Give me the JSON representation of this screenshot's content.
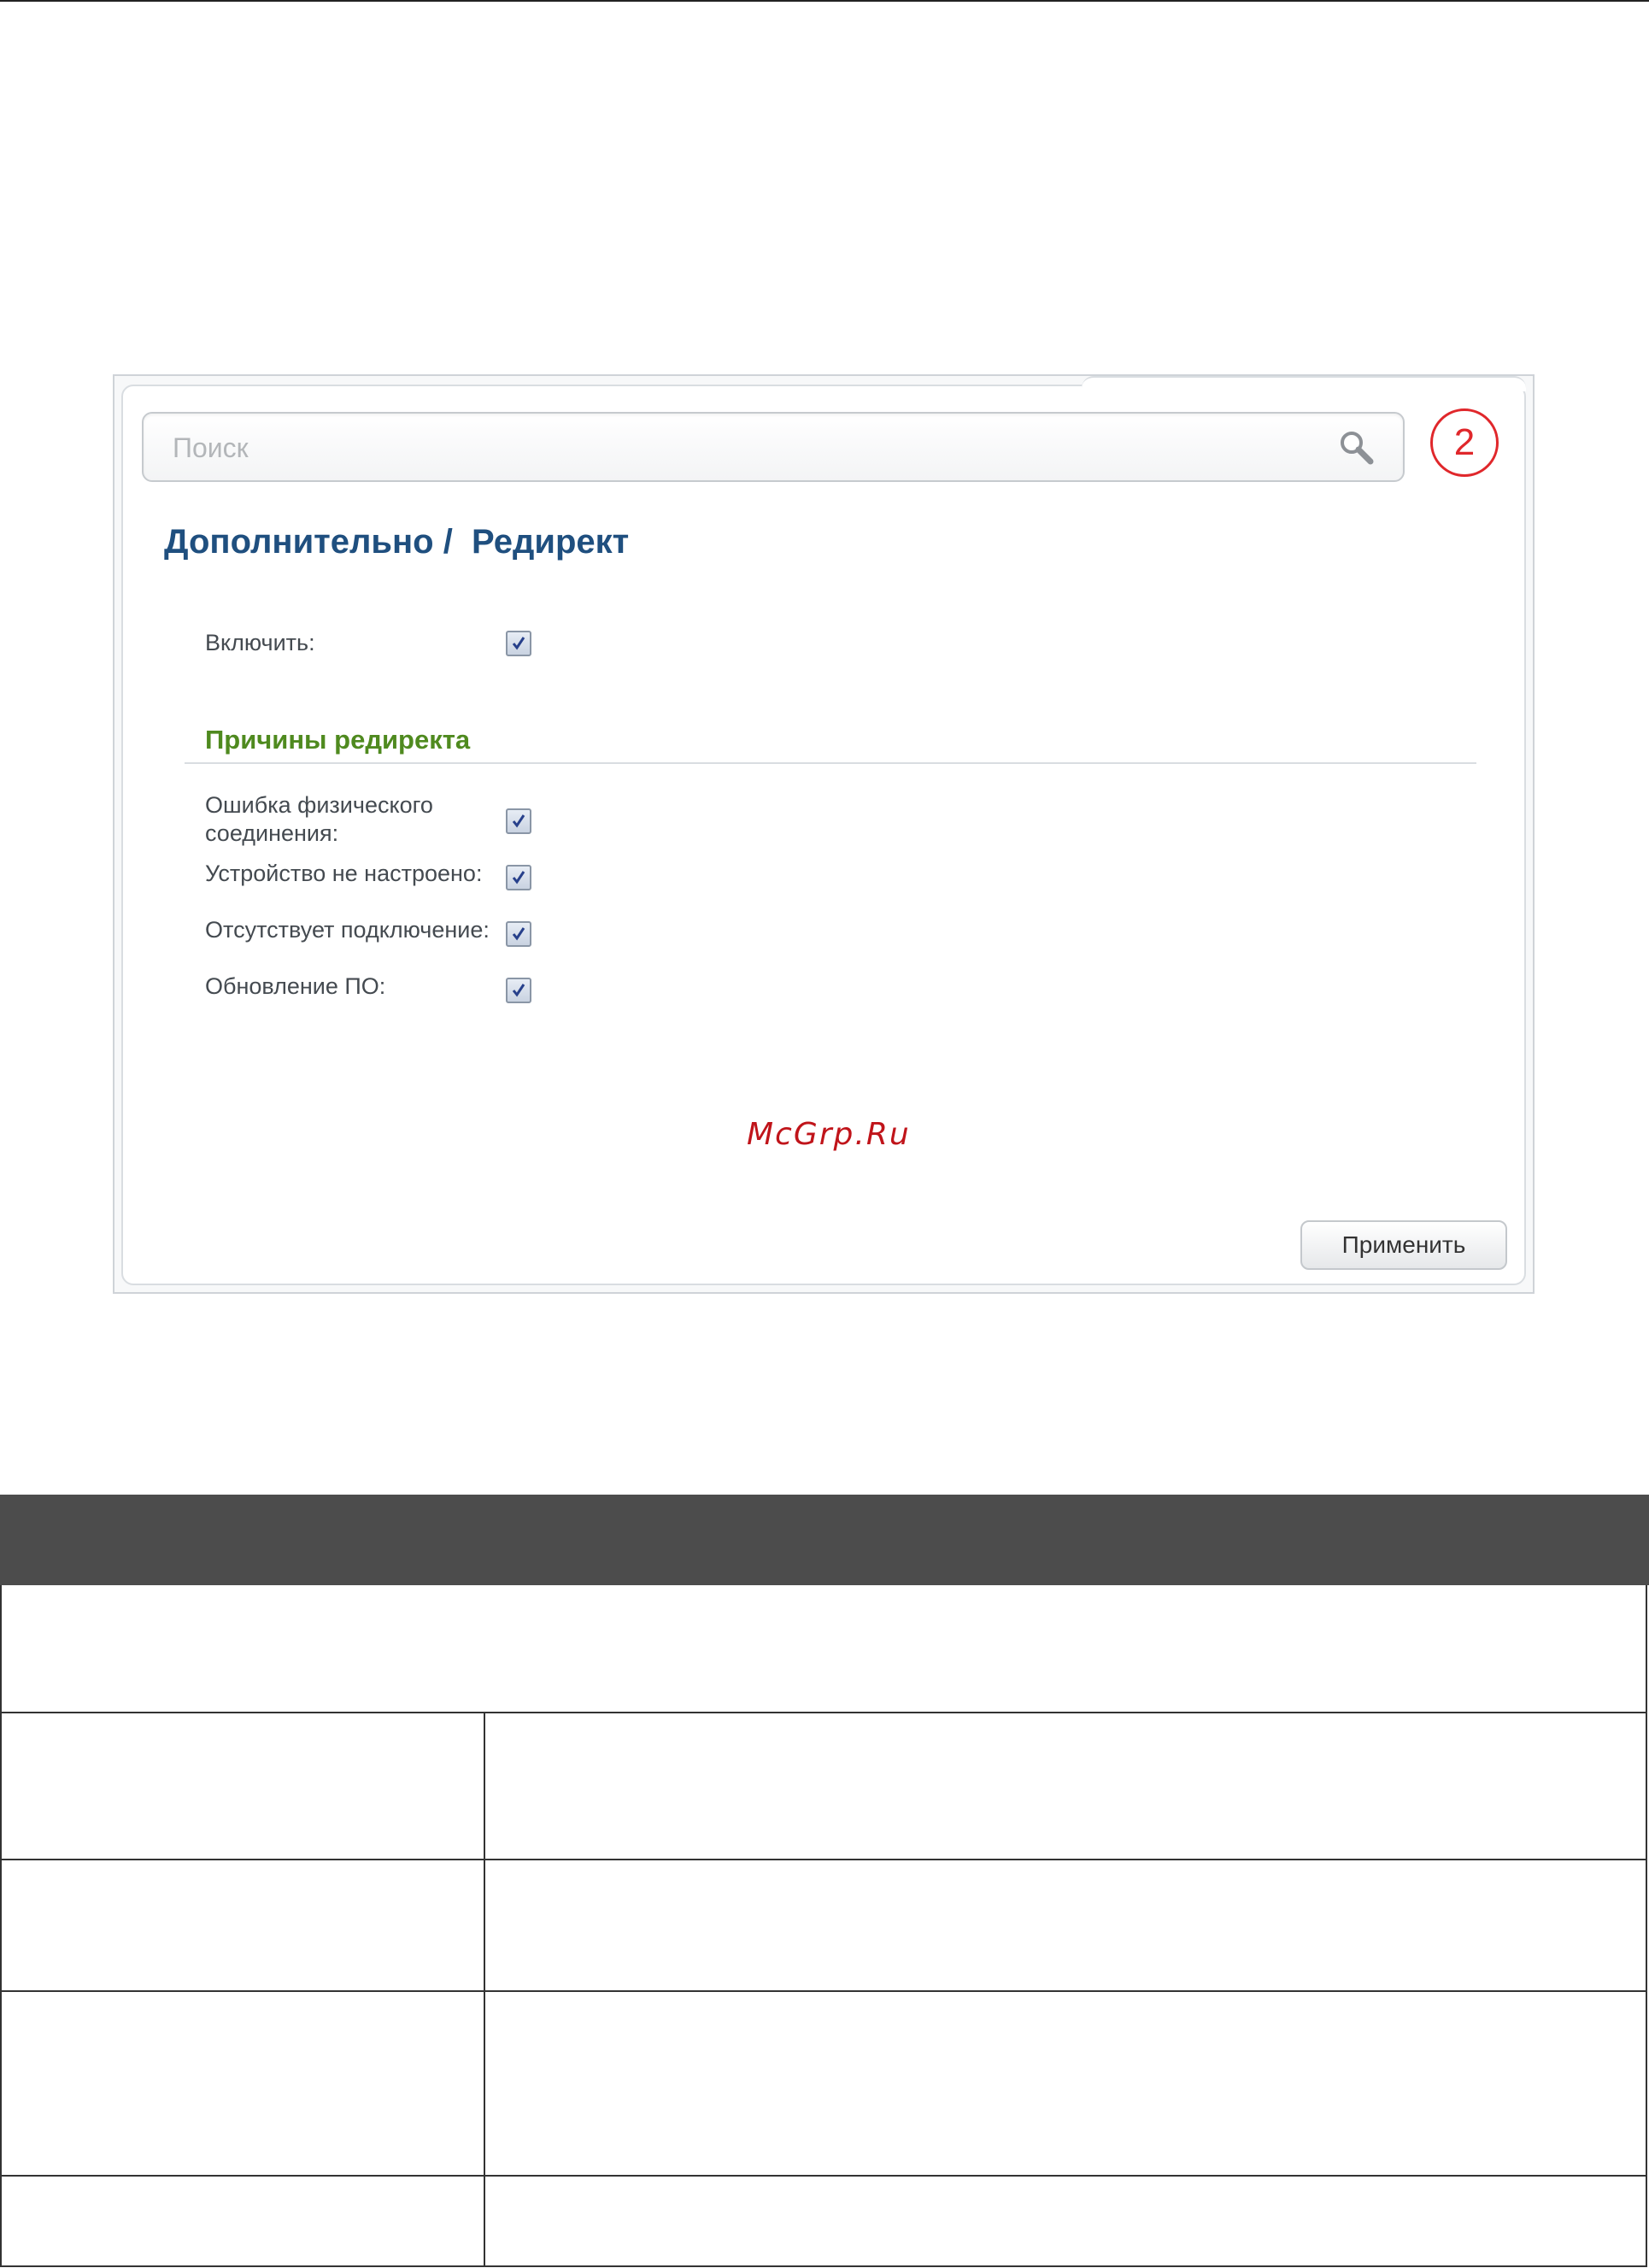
{
  "search": {
    "placeholder": "Поиск"
  },
  "callout": {
    "number": "2"
  },
  "page": {
    "title": "Дополнительно /  Редирект"
  },
  "form": {
    "enable": {
      "label": "Включить:",
      "checked": true
    },
    "section_title": "Причины редиректа",
    "reasons": [
      {
        "label": "Ошибка физического соединения:",
        "checked": true
      },
      {
        "label": "Устройство не настроено:",
        "checked": true
      },
      {
        "label": "Отсутствует подключение:",
        "checked": true
      },
      {
        "label": "Обновление ПО:",
        "checked": true
      }
    ]
  },
  "watermark": "McGrp.Ru",
  "buttons": {
    "apply": "Применить"
  },
  "colors": {
    "title": "#1f4f7f",
    "section": "#4f8a1f",
    "callout": "#e0272b",
    "watermark": "#c0141a",
    "table_header": "#4c4c4c"
  }
}
